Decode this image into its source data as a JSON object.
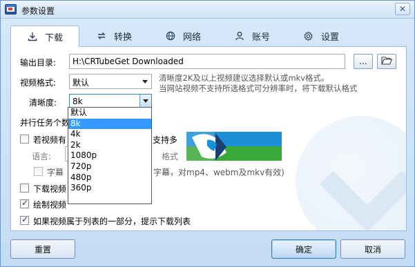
{
  "window": {
    "title": "参数设置",
    "close_glyph": "✕"
  },
  "tabs": [
    {
      "label": "下载",
      "icon": "download-icon",
      "active": true
    },
    {
      "label": "转换",
      "icon": "convert-icon",
      "active": false
    },
    {
      "label": "网络",
      "icon": "globe-icon",
      "active": false
    },
    {
      "label": "账号",
      "icon": "user-icon",
      "active": false
    },
    {
      "label": "设置",
      "icon": "gear-icon",
      "active": false
    }
  ],
  "output_dir": {
    "label": "输出目录:",
    "value": "H:\\CRTubeGet Downloaded",
    "browse_label": "...",
    "open_icon": "folder-open-icon"
  },
  "video_format": {
    "label": "视频格式:",
    "value": "默认",
    "hint_line1": "清晰度2K及以上视频建议选择默认或mkv格式。",
    "hint_line2": "当网站视频不支持所选格式可分辨率时，将下载默认格式"
  },
  "resolution": {
    "label": "清晰度:",
    "value": "8k",
    "options": [
      "默认",
      "8k",
      "4k",
      "2k",
      "1080p",
      "720p",
      "480p",
      "360p"
    ],
    "selected_index": 1
  },
  "parallel_label": "并行任务个数",
  "subtitle": {
    "checkbox_label_start": "若视频有",
    "checkbox_label_end": "支持多",
    "language_label": "语言:",
    "format_label": "格式",
    "embed_label_start": "字幕",
    "embed_label_end": "字幕，对mp4、webm及mkv有效)"
  },
  "download_cover": {
    "label_start": "下载视频"
  },
  "draw_thumbnail": {
    "label_start": "绘制视频",
    "checked": true
  },
  "playlist_prompt": {
    "label": "如果视频属于列表的一部分，提示下载列表",
    "checked": true
  },
  "buttons": {
    "reset": "重置",
    "ok": "确定",
    "cancel": "取消"
  },
  "colors": {
    "accent": "#3399ff",
    "logo_blue": "#1c8fd9",
    "logo_green": "#3aa93a",
    "logo_dark": "#1b3f75"
  }
}
